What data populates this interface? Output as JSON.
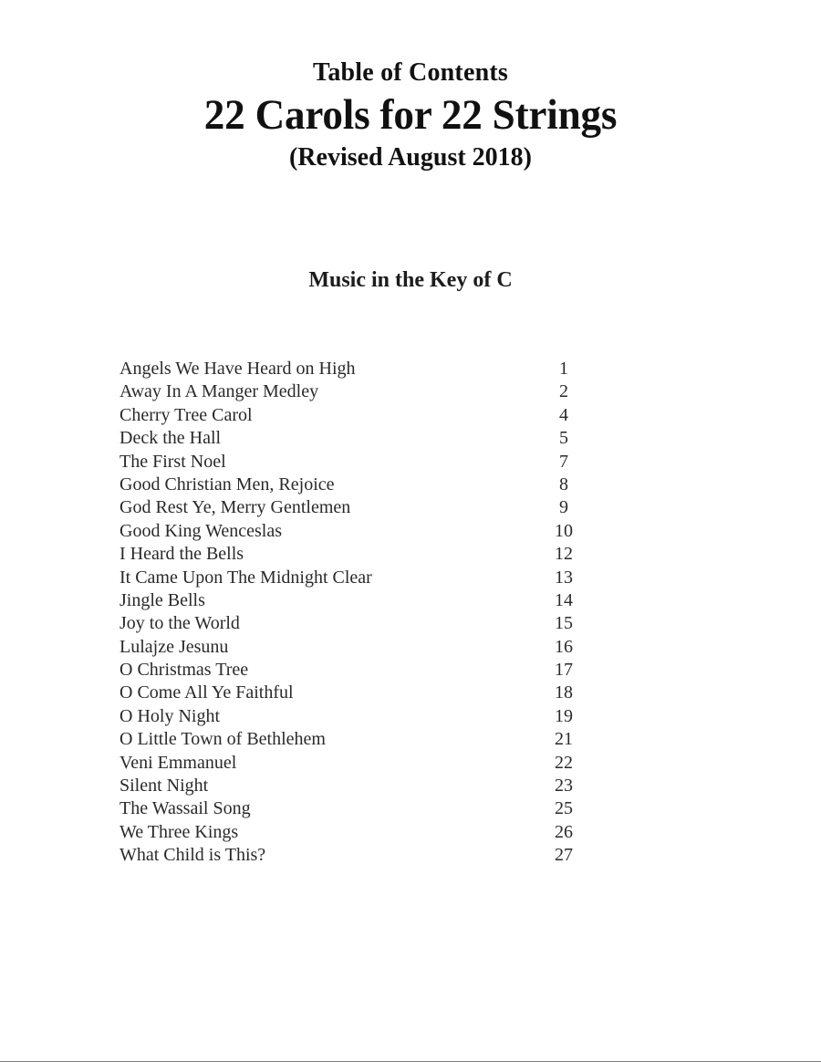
{
  "document": {
    "toc_label": "Table of Contents",
    "book_title": "22 Carols for 22 Strings",
    "revision": "(Revised August 2018)",
    "section_subtitle": "Music in the Key of C"
  },
  "contents": {
    "entries": [
      {
        "title": "Angels We Have Heard on High",
        "page": "1"
      },
      {
        "title": "Away In A Manger Medley",
        "page": "2"
      },
      {
        "title": "Cherry Tree Carol",
        "page": "4"
      },
      {
        "title": "Deck the Hall",
        "page": "5"
      },
      {
        "title": "The First Noel",
        "page": "7"
      },
      {
        "title": "Good Christian Men, Rejoice",
        "page": "8"
      },
      {
        "title": "God Rest Ye, Merry Gentlemen",
        "page": "9"
      },
      {
        "title": "Good King Wenceslas",
        "page": "10"
      },
      {
        "title": "I Heard the Bells",
        "page": "12"
      },
      {
        "title": "It Came Upon The Midnight Clear",
        "page": "13"
      },
      {
        "title": "Jingle Bells",
        "page": "14"
      },
      {
        "title": "Joy to the World",
        "page": "15"
      },
      {
        "title": "Lulajze Jesunu",
        "page": "16"
      },
      {
        "title": "O Christmas Tree",
        "page": "17"
      },
      {
        "title": "O Come All Ye Faithful",
        "page": "18"
      },
      {
        "title": "O Holy Night",
        "page": "19"
      },
      {
        "title": "O Little Town of Bethlehem",
        "page": "21"
      },
      {
        "title": "Veni Emmanuel",
        "page": "22"
      },
      {
        "title": "Silent Night",
        "page": "23"
      },
      {
        "title": "The Wassail Song",
        "page": "25"
      },
      {
        "title": "We Three Kings",
        "page": "26"
      },
      {
        "title": "What Child is This?",
        "page": "27"
      }
    ]
  }
}
